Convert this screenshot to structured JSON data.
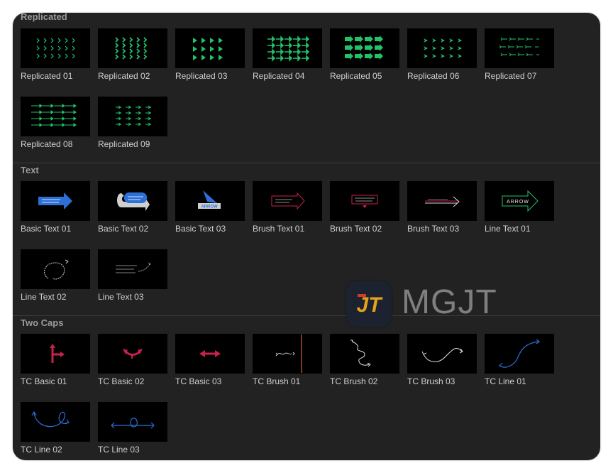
{
  "sections": [
    {
      "title": "Replicated",
      "items": [
        "Replicated 01",
        "Replicated 02",
        "Replicated 03",
        "Replicated 04",
        "Replicated 05",
        "Replicated 06",
        "Replicated 07",
        "Replicated 08",
        "Replicated 09"
      ]
    },
    {
      "title": "Text",
      "items": [
        "Basic Text 01",
        "Basic Text 02",
        "Basic Text 03",
        "Brush Text 01",
        "Brush Text 02",
        "Brush Text 03",
        "Line Text 01",
        "Line Text 02",
        "Line Text 03"
      ]
    },
    {
      "title": "Two Caps",
      "items": [
        "TC Basic 01",
        "TC Basic 02",
        "TC Basic 03",
        "TC Brush 01",
        "TC Brush 02",
        "TC Brush 03",
        "TC Line 01",
        "TC Line 02",
        "TC Line 03"
      ]
    }
  ],
  "thumb_text": {
    "arrow_word": "ARROW",
    "arrow_word_outline": "ARROW"
  },
  "watermark": {
    "text": "MGJT",
    "logo_letters": "JT"
  },
  "colors": {
    "panel_bg": "#222222",
    "replicated_green": "#22c26a",
    "blue": "#2d6fd6",
    "red": "#c8224a",
    "white": "#ffffff"
  }
}
